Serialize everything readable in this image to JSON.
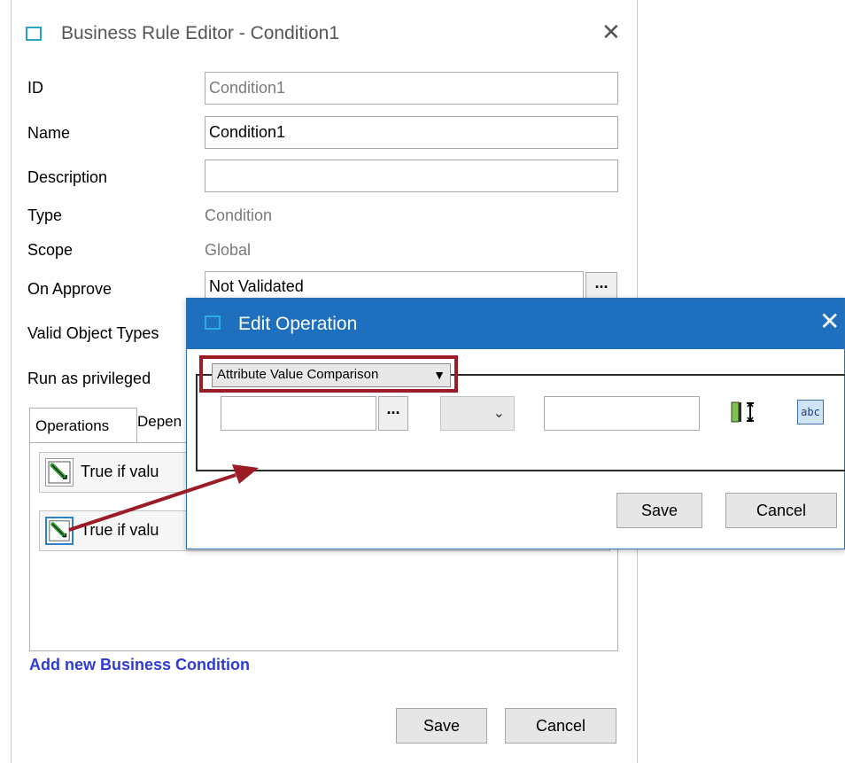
{
  "outer": {
    "title": "Business Rule Editor - Condition1",
    "close_glyph": "✕",
    "labels": {
      "id": "ID",
      "name": "Name",
      "description": "Description",
      "type": "Type",
      "scope": "Scope",
      "on_approve": "On Approve",
      "valid_object_types": "Valid Object Types",
      "run_as_privileged": "Run as privileged"
    },
    "fields": {
      "id": "Condition1",
      "name": "Condition1",
      "description": "",
      "type": "Condition",
      "scope": "Global",
      "on_approve": "Not Validated",
      "browse": "..."
    },
    "tabs": [
      "Operations",
      "Depen"
    ],
    "operations": [
      "True if valu",
      "True if valu"
    ],
    "add_link": "Add new Business Condition",
    "save": "Save",
    "cancel": "Cancel"
  },
  "edit": {
    "title": "Edit Operation",
    "close_glyph": "✕",
    "operation_type": "Attribute Value Comparison",
    "dropdown_arrow": "▼",
    "attribute_value": "",
    "browse": "...",
    "operator_chevron": "⌄",
    "value": "",
    "abc": "abc",
    "save": "Save",
    "cancel": "Cancel"
  },
  "colors": {
    "titlebar": "#1e6fbe",
    "highlight": "#9c1c26",
    "link": "#2f3bd3"
  },
  "icons": [
    "window-icon",
    "close-icon",
    "condition-icon",
    "browse-icon",
    "chevron-down-icon",
    "height-icon",
    "abc-icon",
    "annotation-arrow"
  ]
}
